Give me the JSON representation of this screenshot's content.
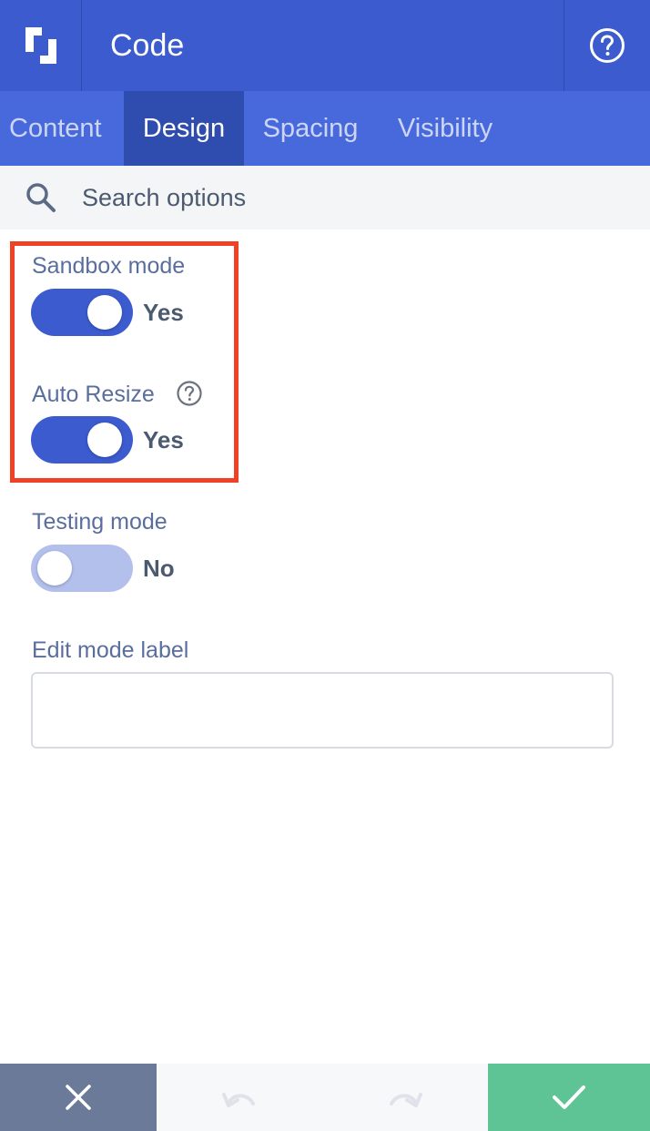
{
  "header": {
    "title": "Code",
    "logo_icon": "builder-logo-icon",
    "help_icon": "help-circle-icon"
  },
  "tabs": [
    {
      "label": "Content",
      "active": false
    },
    {
      "label": "Design",
      "active": true
    },
    {
      "label": "Spacing",
      "active": false
    },
    {
      "label": "Visibility",
      "active": false
    }
  ],
  "search": {
    "placeholder": "Search options",
    "icon": "search-icon"
  },
  "options": {
    "sandbox": {
      "label": "Sandbox mode",
      "state": "Yes",
      "on": true
    },
    "auto_resize": {
      "label": "Auto Resize",
      "state": "Yes",
      "on": true,
      "help_icon": "question-circle-icon"
    },
    "testing": {
      "label": "Testing mode",
      "state": "No",
      "on": false
    },
    "edit_label": {
      "label": "Edit mode label",
      "value": ""
    }
  },
  "footer": {
    "close_icon": "close-icon",
    "undo_icon": "undo-icon",
    "redo_icon": "redo-icon",
    "save_icon": "checkmark-icon"
  },
  "colors": {
    "header": "#3b5bcf",
    "tabs": "#4869db",
    "active_tab": "#2f4caf",
    "toggle_on": "#3b5bcf",
    "toggle_off": "#b3c0ec",
    "highlight": "#ee4128",
    "close_button": "#6b7a99",
    "save_button": "#5ec495"
  }
}
